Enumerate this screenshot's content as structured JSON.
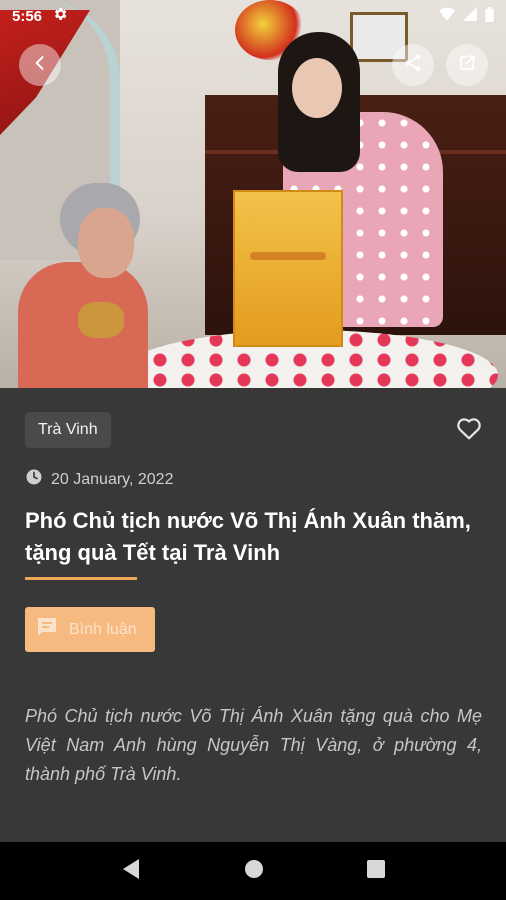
{
  "status_bar": {
    "time": "5:56"
  },
  "article": {
    "category": "Trà Vinh",
    "date": "20 January, 2022",
    "title": "Phó Chủ tịch nước Võ Thị Ánh Xuân thăm, tặng quà Tết tại Trà Vinh",
    "comment_label": "Bình luận",
    "summary": "Phó Chủ tịch nước Võ Thị Ánh Xuân tặng quà cho Mẹ Việt Nam Anh hùng Nguyễn Thị Vàng, ở phường 4, thành phố Trà Vinh."
  },
  "colors": {
    "accent": "#f2a65a",
    "comment_button": "#f6ba80",
    "background": "#383838",
    "chip": "#4a4a4a"
  },
  "icons": {
    "back": "back-arrow-icon",
    "share": "share-icon",
    "open_external": "open-external-icon",
    "favorite": "heart-outline-icon",
    "clock": "clock-icon",
    "comment": "comment-icon",
    "settings": "gear-icon",
    "wifi": "wifi-icon",
    "signal": "signal-icon",
    "battery": "battery-icon",
    "nav_back": "nav-back-icon",
    "nav_home": "nav-home-icon",
    "nav_recents": "nav-recents-icon"
  }
}
